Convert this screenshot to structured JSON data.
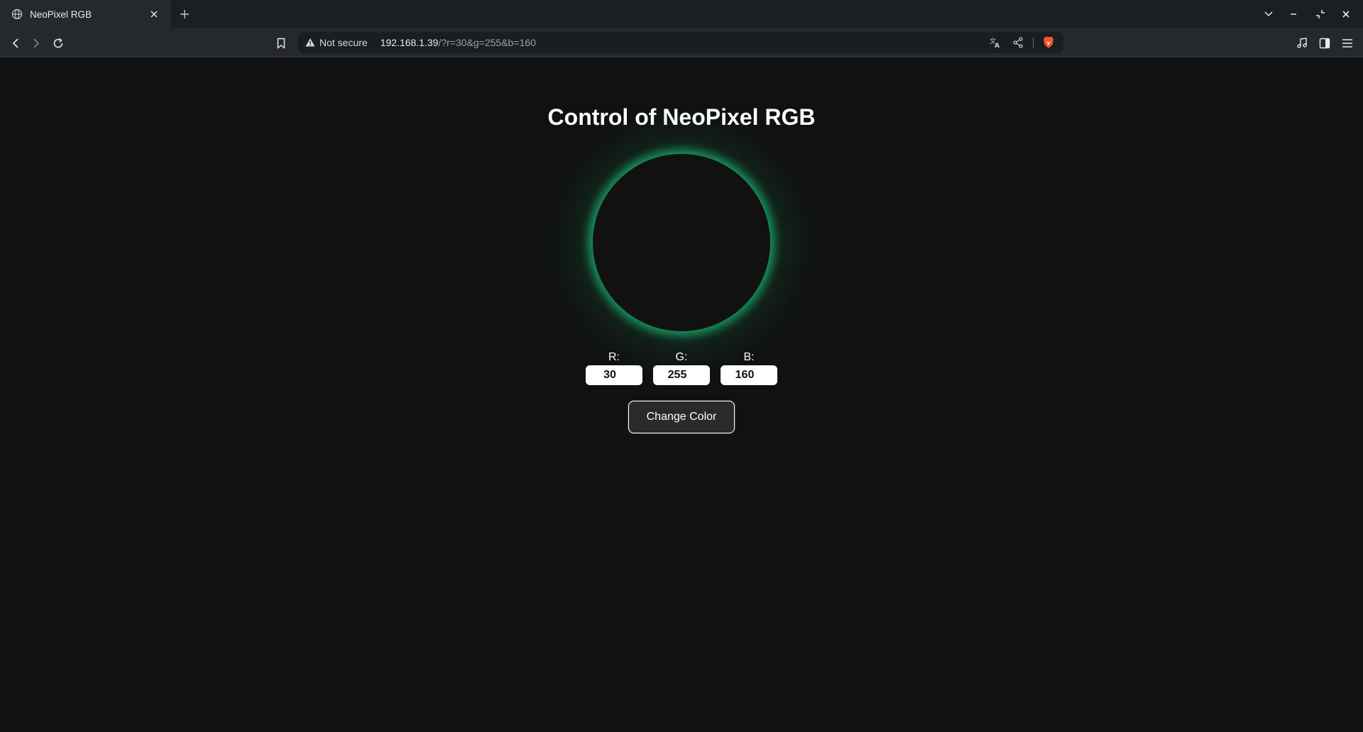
{
  "browser": {
    "tab": {
      "title": "NeoPixel RGB",
      "favicon": "globe-icon"
    },
    "address": {
      "security_label": "Not secure",
      "host": "192.168.1.39",
      "path": "/?r=30&g=255&b=160"
    }
  },
  "page": {
    "title": "Control of NeoPixel RGB",
    "led_color": "#1effa0",
    "fields": {
      "r": {
        "label": "R:",
        "value": "30"
      },
      "g": {
        "label": "G:",
        "value": "255"
      },
      "b": {
        "label": "B:",
        "value": "160"
      }
    },
    "button_label": "Change Color"
  },
  "colors": {
    "background": "#111111",
    "accent_glow": "#1effa0",
    "brave_lion": "#fb542b"
  }
}
